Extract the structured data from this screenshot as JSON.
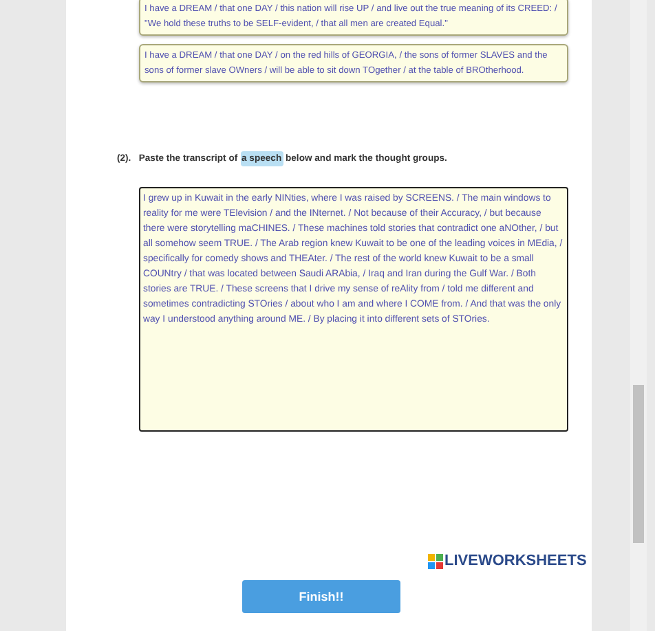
{
  "examples": [
    {
      "text": "I have a DREAM / that one DAY / this nation will rise UP / and live out the true meaning of its CREED: / \"We hold these truths to be SELF-evident, / that all men are created Equal.\""
    },
    {
      "text": "I have a DREAM / that one DAY / on the red hills of GEORGIA, / the sons of former SLAVES and the sons of former slave OWners / will be able to sit down TOgether / at the table of BROtherhood."
    }
  ],
  "question": {
    "number": "(2).",
    "before": "Paste the transcript of",
    "highlight": "a speech",
    "after": "below and mark the thought groups."
  },
  "answer": {
    "value": "I grew up in Kuwait in the early NINties, where I was raised by SCREENS. / The main windows to reality for me were TElevision / and the INternet. / Not because of their Accuracy, / but because there were storytelling maCHINES. / These machines told stories that contradict one aNOther, / but all somehow seem TRUE. / The Arab region knew Kuwait to be one of the leading voices in MEdia, / specifically for comedy shows and THEAter. / The rest of the world knew Kuwait to be a small COUNtry / that was located between Saudi ARAbia, / Iraq and Iran during the Gulf War. / Both stories are TRUE. / These screens that I drive my sense of reAlity from / told me different and sometimes contradicting STOries / about who I am and where I COME from. / And that was the only way I understood anything around ME. / By placing it into different sets of STOries."
  },
  "logo": {
    "text": "LIVEWORKSHEETS"
  },
  "finish_button": {
    "label": "Finish!!"
  }
}
